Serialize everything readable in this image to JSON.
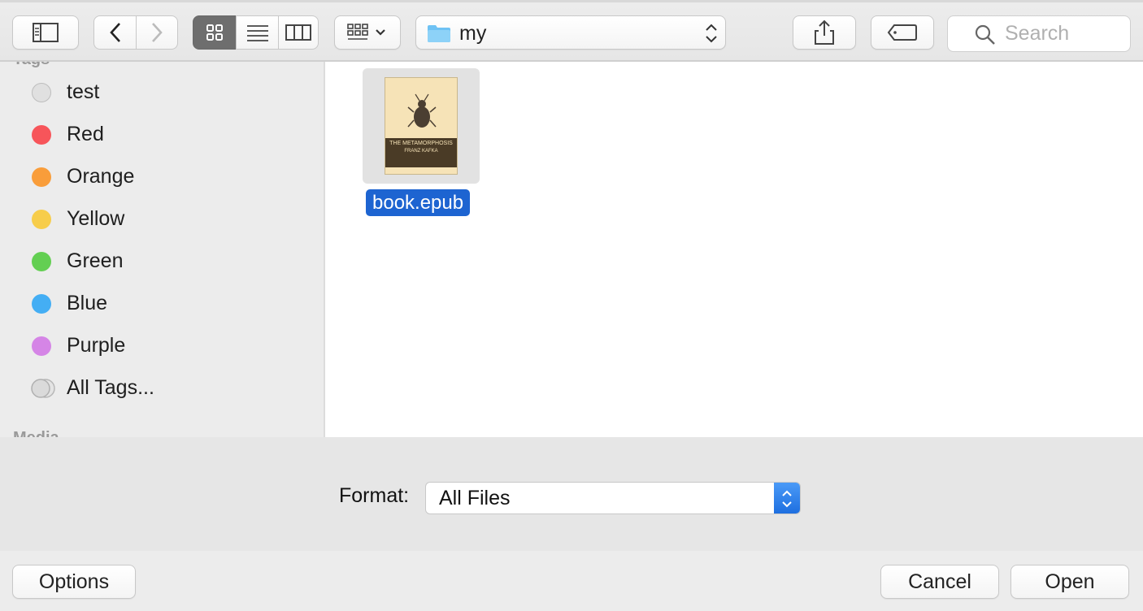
{
  "toolbar": {
    "path_label": "my",
    "search_placeholder": "Search"
  },
  "sidebar": {
    "partial_header_top": "Tags",
    "partial_header_bottom": "Media",
    "tags": [
      {
        "label": "test",
        "color": "#d8d8d8"
      },
      {
        "label": "Red",
        "color": "#f7555a"
      },
      {
        "label": "Orange",
        "color": "#f99d3a"
      },
      {
        "label": "Yellow",
        "color": "#f7cd4a"
      },
      {
        "label": "Green",
        "color": "#63cf52"
      },
      {
        "label": "Blue",
        "color": "#44aef4"
      },
      {
        "label": "Purple",
        "color": "#d585e6"
      },
      {
        "label": "All Tags...",
        "color": "#d8d8d8"
      }
    ]
  },
  "files": [
    {
      "name": "book.epub",
      "thumb_title": "THE METAMORPHOSIS",
      "thumb_author": "FRANZ KAFKA"
    }
  ],
  "format": {
    "label": "Format:",
    "selected": "All Files"
  },
  "buttons": {
    "options": "Options",
    "cancel": "Cancel",
    "open": "Open"
  },
  "colors": {
    "selection": "#1d64d1",
    "select_accent": "#2f80ec"
  }
}
